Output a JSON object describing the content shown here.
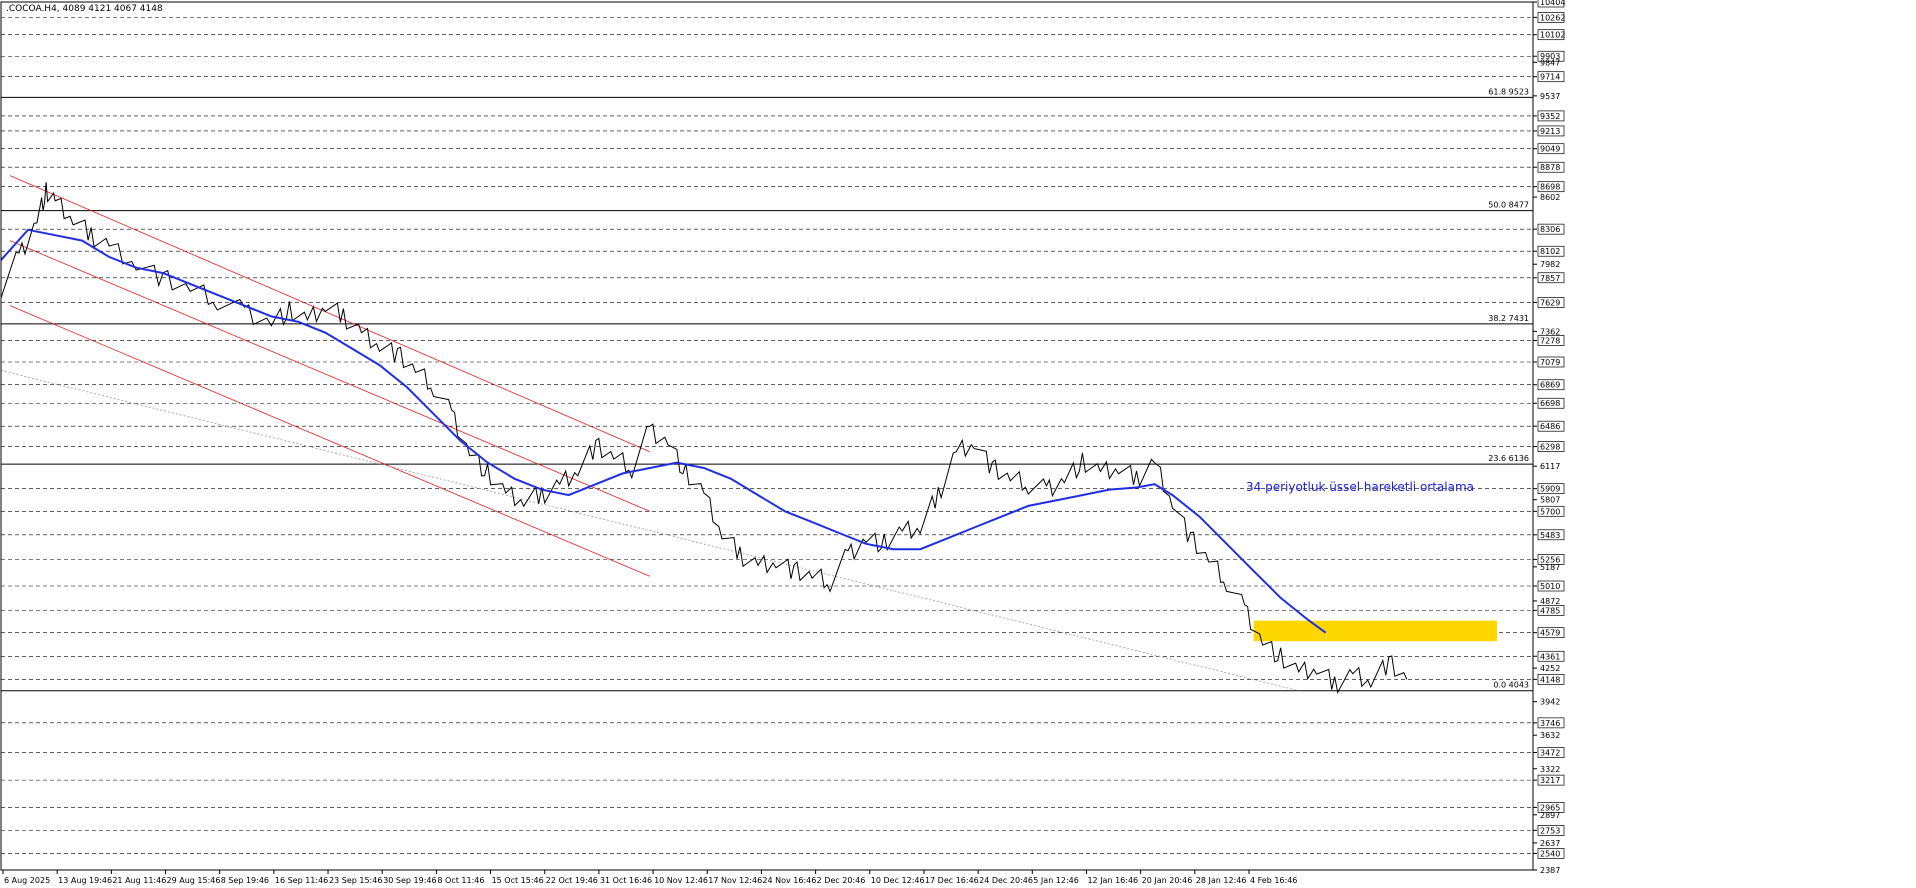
{
  "header": {
    "symbol_line": ".COCOA.H4, 4089 4121 4067 4148"
  },
  "chart_data": {
    "type": "line",
    "title": ".COCOA.H4",
    "ohlc_header": "4089 4121 4067 4148",
    "ylim": [
      2387,
      10404
    ],
    "price_ticks": [
      "10404",
      "10262",
      "10102",
      "9903",
      "9847",
      "9714",
      "9537",
      "9352",
      "9213",
      "9049",
      "8878",
      "8698",
      "8602",
      "8306",
      "8102",
      "7982",
      "7857",
      "7629",
      "7362",
      "7278",
      "7079",
      "6869",
      "6698",
      "6486",
      "6298",
      "6117",
      "5909",
      "5807",
      "5700",
      "5483",
      "5256",
      "5187",
      "5010",
      "4872",
      "4785",
      "4579",
      "4361",
      "4252",
      "4148",
      "3942",
      "3746",
      "3632",
      "3472",
      "3322",
      "3217",
      "2965",
      "2897",
      "2753",
      "2637",
      "2540",
      "2387"
    ],
    "boxed_ticks": [
      "10404",
      "10262",
      "10102",
      "9903",
      "9714",
      "9352",
      "9213",
      "9049",
      "8878",
      "8698",
      "8306",
      "8102",
      "7857",
      "7629",
      "7278",
      "7079",
      "6869",
      "6698",
      "6486",
      "6298",
      "5909",
      "5700",
      "5483",
      "5256",
      "5010",
      "4785",
      "4579",
      "4361",
      "4148",
      "3746",
      "3472",
      "3217",
      "2965",
      "2753",
      "2540"
    ],
    "x_ticks": [
      "6 Aug 2025",
      "13 Aug 19:46",
      "21 Aug 11:46",
      "29 Aug 15:46",
      "8 Sep 19:46",
      "16 Sep 11:46",
      "23 Sep 15:46",
      "30 Sep 19:46",
      "8 Oct 11:46",
      "15 Oct 15:46",
      "22 Oct 19:46",
      "31 Oct 16:46",
      "10 Nov 12:46",
      "17 Nov 12:46",
      "24 Nov 16:46",
      "2 Dec 20:46",
      "10 Dec 12:46",
      "17 Dec 16:46",
      "24 Dec 20:46",
      "5 Jan 12:46",
      "12 Jan 16:46",
      "20 Jan 20:46",
      "28 Jan 12:46",
      "4 Feb 16:46"
    ],
    "fib_levels": [
      {
        "label": "61.8 9523",
        "value": 9523
      },
      {
        "label": "50.0 8477",
        "value": 8477
      },
      {
        "label": "38.2 7431",
        "value": 7431
      },
      {
        "label": "23.6 6136",
        "value": 6136
      },
      {
        "label": "0.0 4043",
        "value": 4043
      }
    ],
    "annotation": "34 periyotluk üssel hareketli ortalama",
    "colors": {
      "price": "#000000",
      "ema": "#1f2fe0",
      "channel": "#e02020",
      "zone": "#ffd700",
      "annotation": "#2020e0",
      "grid": "#000000"
    },
    "price_path": [
      [
        0,
        7760
      ],
      [
        2,
        8050
      ],
      [
        4,
        8400
      ],
      [
        5,
        8650
      ],
      [
        6,
        8550
      ],
      [
        8,
        8400
      ],
      [
        10,
        8250
      ],
      [
        12,
        8150
      ],
      [
        15,
        8000
      ],
      [
        18,
        7850
      ],
      [
        21,
        7750
      ],
      [
        24,
        7650
      ],
      [
        27,
        7550
      ],
      [
        30,
        7450
      ],
      [
        32,
        7550
      ],
      [
        34,
        7450
      ],
      [
        36,
        7600
      ],
      [
        38,
        7500
      ],
      [
        40,
        7350
      ],
      [
        42,
        7250
      ],
      [
        44,
        7150
      ],
      [
        46,
        7000
      ],
      [
        48,
        6850
      ],
      [
        50,
        6600
      ],
      [
        52,
        6250
      ],
      [
        54,
        6050
      ],
      [
        56,
        5850
      ],
      [
        58,
        5800
      ],
      [
        60,
        5850
      ],
      [
        62,
        5950
      ],
      [
        64,
        6100
      ],
      [
        66,
        6300
      ],
      [
        68,
        6200
      ],
      [
        70,
        6100
      ],
      [
        72,
        6450
      ],
      [
        74,
        6350
      ],
      [
        76,
        6050
      ],
      [
        78,
        5850
      ],
      [
        80,
        5500
      ],
      [
        82,
        5300
      ],
      [
        84,
        5200
      ],
      [
        86,
        5250
      ],
      [
        88,
        5150
      ],
      [
        90,
        5100
      ],
      [
        92,
        5050
      ],
      [
        94,
        5300
      ],
      [
        96,
        5450
      ],
      [
        98,
        5400
      ],
      [
        100,
        5500
      ],
      [
        102,
        5550
      ],
      [
        104,
        5850
      ],
      [
        106,
        6250
      ],
      [
        108,
        6350
      ],
      [
        110,
        6100
      ],
      [
        112,
        6000
      ],
      [
        114,
        5950
      ],
      [
        116,
        5900
      ],
      [
        118,
        6000
      ],
      [
        120,
        6150
      ],
      [
        122,
        6050
      ],
      [
        124,
        6100
      ],
      [
        126,
        6000
      ],
      [
        128,
        6150
      ],
      [
        130,
        5800
      ],
      [
        132,
        5450
      ],
      [
        134,
        5250
      ],
      [
        136,
        5050
      ],
      [
        138,
        4800
      ],
      [
        140,
        4500
      ],
      [
        142,
        4350
      ],
      [
        144,
        4200
      ],
      [
        146,
        4250
      ],
      [
        148,
        4100
      ],
      [
        150,
        4200
      ],
      [
        152,
        4150
      ],
      [
        154,
        4300
      ],
      [
        156,
        4148
      ]
    ],
    "ema_path": [
      [
        0,
        8020
      ],
      [
        3,
        8300
      ],
      [
        6,
        8250
      ],
      [
        9,
        8200
      ],
      [
        12,
        8050
      ],
      [
        15,
        7950
      ],
      [
        18,
        7900
      ],
      [
        21,
        7800
      ],
      [
        24,
        7700
      ],
      [
        27,
        7600
      ],
      [
        30,
        7500
      ],
      [
        33,
        7450
      ],
      [
        36,
        7350
      ],
      [
        39,
        7200
      ],
      [
        42,
        7050
      ],
      [
        45,
        6850
      ],
      [
        48,
        6600
      ],
      [
        51,
        6350
      ],
      [
        54,
        6150
      ],
      [
        57,
        6000
      ],
      [
        60,
        5900
      ],
      [
        63,
        5850
      ],
      [
        66,
        5950
      ],
      [
        69,
        6050
      ],
      [
        72,
        6100
      ],
      [
        75,
        6150
      ],
      [
        78,
        6100
      ],
      [
        81,
        6000
      ],
      [
        84,
        5850
      ],
      [
        87,
        5700
      ],
      [
        90,
        5600
      ],
      [
        93,
        5500
      ],
      [
        96,
        5400
      ],
      [
        99,
        5350
      ],
      [
        102,
        5350
      ],
      [
        105,
        5450
      ],
      [
        108,
        5550
      ],
      [
        111,
        5650
      ],
      [
        114,
        5750
      ],
      [
        117,
        5800
      ],
      [
        120,
        5850
      ],
      [
        123,
        5900
      ],
      [
        126,
        5920
      ],
      [
        128,
        5950
      ],
      [
        130,
        5850
      ],
      [
        133,
        5650
      ],
      [
        136,
        5400
      ],
      [
        139,
        5150
      ],
      [
        142,
        4900
      ],
      [
        145,
        4700
      ],
      [
        147,
        4579
      ]
    ],
    "zone": {
      "x_from": 139,
      "x_to": 166,
      "y_low": 4500,
      "y_high": 4690
    },
    "channel_lines": [
      {
        "x1": 1,
        "y1": 8800,
        "x2": 72,
        "y2": 6250
      },
      {
        "x1": 1,
        "y1": 8200,
        "x2": 72,
        "y2": 5700
      },
      {
        "x1": 1,
        "y1": 7600,
        "x2": 72,
        "y2": 5100
      }
    ],
    "trendline": {
      "x1": 0,
      "y1": 7000,
      "x2": 144,
      "y2": 4043
    },
    "xlabel": "",
    "ylabel": "",
    "grid": true
  }
}
